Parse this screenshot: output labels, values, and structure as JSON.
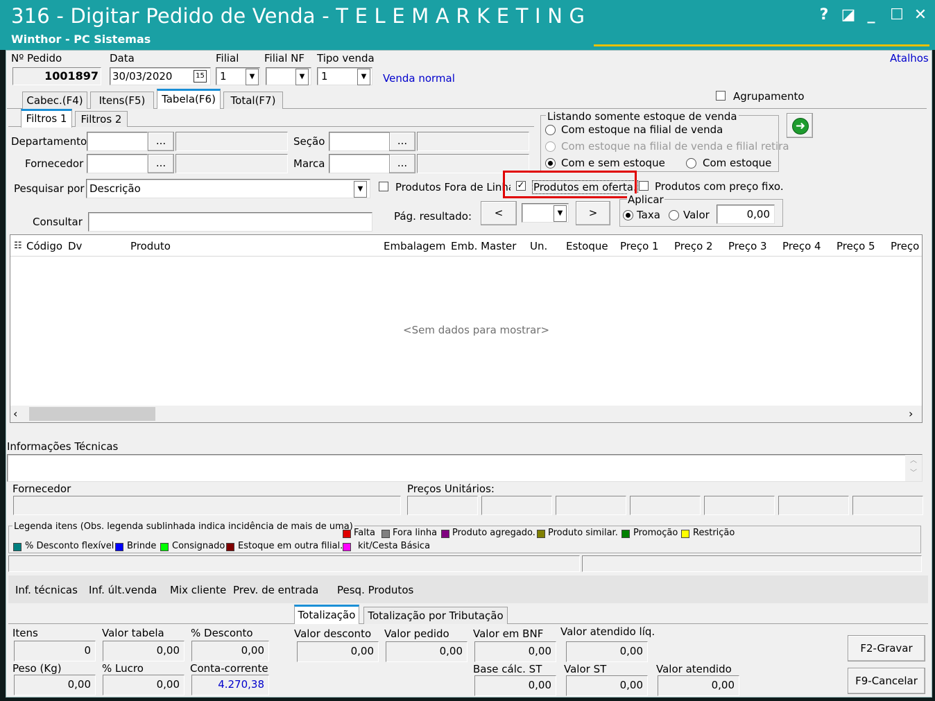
{
  "window": {
    "title": "316 - Digitar Pedido de Venda - T E L E M A R K E T I N G",
    "subtitle": "Winthor - PC Sistemas",
    "controls": {
      "help": "?",
      "restore": "◪",
      "minimize": "_",
      "maximize": "☐",
      "close": "✕"
    }
  },
  "header": {
    "pedido_label": "Nº Pedido",
    "pedido_value": "1001897",
    "data_label": "Data",
    "data_value": "30/03/2020",
    "filial_label": "Filial",
    "filial_value": "1",
    "filialnf_label": "Filial NF",
    "filialnf_value": "",
    "tipovenda_label": "Tipo venda",
    "tipovenda_value": "1",
    "tipovenda_desc": "Venda normal",
    "atalhos": "Atalhos"
  },
  "tabs": [
    "Cabec.(F4)",
    "Itens(F5)",
    "Tabela(F6)",
    "Total(F7)"
  ],
  "agrupamento_label": "Agrupamento",
  "subtabs": [
    "Filtros 1",
    "Filtros 2"
  ],
  "filters": {
    "departamento_label": "Departamento",
    "fornecedor_label": "Fornecedor",
    "secao_label": "Seção",
    "marca_label": "Marca",
    "ellipsis": "...",
    "pesquisar_label": "Pesquisar por",
    "pesquisar_value": "Descrição",
    "consultar_label": "Consultar",
    "fora_linha": "Produtos Fora de Linha",
    "em_oferta": "Produtos em oferta.",
    "preco_fixo": "Produtos com preço fixo.",
    "pag_resultado": "Pág. resultado:",
    "prev": "<",
    "next": ">"
  },
  "estoque": {
    "legend": "Listando somente estoque de venda",
    "opt1": "Com estoque na filial de venda",
    "opt2": "Com estoque na filial de venda e filial retira",
    "opt3": "Com e sem estoque",
    "opt4": "Com estoque"
  },
  "aplicar": {
    "legend": "Aplicar",
    "taxa": "Taxa",
    "valor": "Valor",
    "value": "0,00"
  },
  "grid": {
    "columns": [
      "Código",
      "Dv",
      "Produto",
      "Embalagem",
      "Emb. Master",
      "Un.",
      "Estoque",
      "Preço 1",
      "Preço 2",
      "Preço 3",
      "Preço 4",
      "Preço 5",
      "Preço"
    ],
    "empty": "<Sem dados para mostrar>"
  },
  "info": {
    "tecnicas_label": "Informações Técnicas",
    "fornecedor_label": "Fornecedor",
    "precos_label": "Preços Unitários:"
  },
  "legenda": {
    "title": "Legenda itens (Obs. legenda sublinhada indica incidência de mais de uma)",
    "items": [
      {
        "label": "Falta",
        "color": "#e00000"
      },
      {
        "label": "Fora linha",
        "color": "#808080"
      },
      {
        "label": "Produto agregado.",
        "color": "#800080"
      },
      {
        "label": "Produto similar.",
        "color": "#808000"
      },
      {
        "label": "Promoção",
        "color": "#008000"
      },
      {
        "label": "Restrição",
        "color": "#ffff00"
      },
      {
        "label": "% Desconto flexível",
        "color": "#008080"
      },
      {
        "label": "Brinde",
        "color": "#0000ff"
      },
      {
        "label": "Consignado",
        "color": "#00ff00"
      },
      {
        "label": "Estoque em outra filial.",
        "color": "#800000"
      },
      {
        "label": "kit/Cesta Básica",
        "color": "#ff00ff"
      }
    ]
  },
  "bottom_links": [
    "Inf. técnicas",
    "Inf. últ.venda",
    "Mix cliente",
    "Prev. de entrada",
    "Pesq. Produtos"
  ],
  "totals_tabs": [
    "Totalização",
    "Totalização por Tributação"
  ],
  "totals": {
    "itens_label": "Itens",
    "itens": "0",
    "valortabela_label": "Valor tabela",
    "valortabela": "0,00",
    "desconto_label": "% Desconto",
    "desconto": "0,00",
    "peso_label": "Peso (Kg)",
    "peso": "0,00",
    "lucro_label": "% Lucro",
    "lucro": "0,00",
    "conta_label": "Conta-corrente",
    "conta": "4.270,38",
    "valordesconto_label": "Valor desconto",
    "valordesconto": "0,00",
    "valorpedido_label": "Valor pedido",
    "valorpedido": "0,00",
    "valorbnf_label": "Valor em BNF",
    "valorbnf": "0,00",
    "atendidoliq_label": "Valor atendido líq.",
    "atendidoliq": "0,00",
    "basest_label": "Base cálc. ST",
    "basest": "0,00",
    "valorst_label": "Valor ST",
    "valorst": "0,00",
    "atendido_label": "Valor atendido",
    "atendido": "0,00"
  },
  "buttons": {
    "gravar": "F2-Gravar",
    "cancelar": "F9-Cancelar"
  },
  "colors": {
    "titlebar": "#1aa0a4",
    "highlight": "#e00000",
    "link": "#0000cc"
  }
}
